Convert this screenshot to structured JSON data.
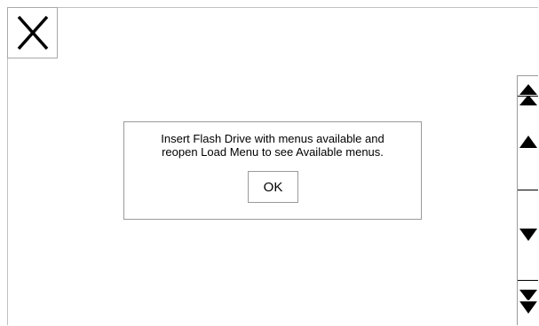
{
  "window": {
    "close_icon": "x-icon"
  },
  "dialog": {
    "message_line1": "Insert Flash Drive with menus available and",
    "message_line2": "reopen Load Menu to see Available menus.",
    "ok_label": "OK"
  },
  "scrollbar": {
    "top_icon": "double-up-arrow-icon",
    "up_icon": "up-arrow-icon",
    "down_icon": "down-arrow-icon",
    "bottom_icon": "double-down-arrow-icon"
  }
}
